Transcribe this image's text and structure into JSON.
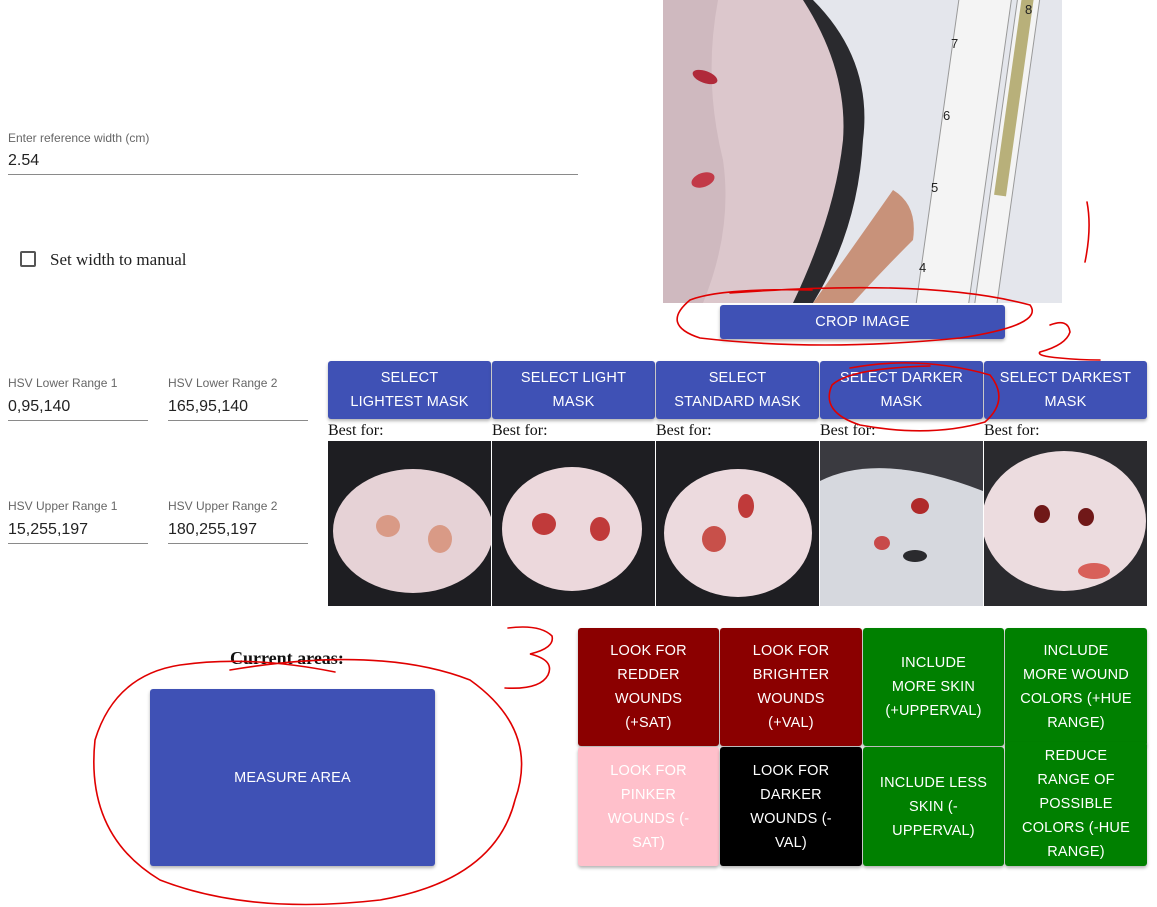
{
  "reference_width": {
    "label": "Enter reference width (cm)",
    "value": "2.54"
  },
  "manual_width": {
    "label": "Set width to manual",
    "checked": false
  },
  "hsv": {
    "lower1": {
      "label": "HSV Lower Range 1",
      "value": "0,95,140"
    },
    "lower2": {
      "label": "HSV Lower Range 2",
      "value": "165,95,140"
    },
    "upper1": {
      "label": "HSV Upper Range 1",
      "value": "15,255,197"
    },
    "upper2": {
      "label": "HSV Upper Range 2",
      "value": "180,255,197"
    }
  },
  "crop_button": "CROP IMAGE",
  "masks": [
    {
      "label": "SELECT\nLIGHTEST MASK",
      "best": "Best for:"
    },
    {
      "label": "SELECT LIGHT\nMASK",
      "best": "Best for:"
    },
    {
      "label": "SELECT\nSTANDARD MASK",
      "best": "Best for:"
    },
    {
      "label": "SELECT DARKER\nMASK",
      "best": "Best for:"
    },
    {
      "label": "SELECT DARKEST\nMASK",
      "best": "Best for:"
    }
  ],
  "current_areas": "Current areas:",
  "measure_button": "MEASURE AREA",
  "adjust": {
    "redder": "LOOK FOR\nREDDER\nWOUNDS\n(+SAT)",
    "brighter": "LOOK FOR\nBRIGHTER\nWOUNDS\n(+VAL)",
    "more_skin": "INCLUDE\nMORE SKIN\n(+UPPERVAL)",
    "more_colors": "INCLUDE\nMORE WOUND\nCOLORS (+HUE\nRANGE)",
    "pinker": "LOOK FOR\nPINKER\nWOUNDS (-\nSAT)",
    "darker": "LOOK FOR\nDARKER\nWOUNDS (-\nVAL)",
    "less_skin": "INCLUDE LESS\nSKIN (-\nUPPERVAL)",
    "fewer_colors": "REDUCE\nRANGE OF\nPOSSIBLE\nCOLORS (-HUE\nRANGE)"
  },
  "annotations": {
    "two": "2",
    "three": "3"
  },
  "ruler_numbers": [
    "8",
    "7",
    "6",
    "5",
    "4"
  ],
  "colors": {
    "primary": "#3f51b5",
    "dark_red": "#8b0000",
    "green": "#008000",
    "pink": "#ffc0cb",
    "black": "#000000",
    "annotation_red": "#e00000"
  }
}
